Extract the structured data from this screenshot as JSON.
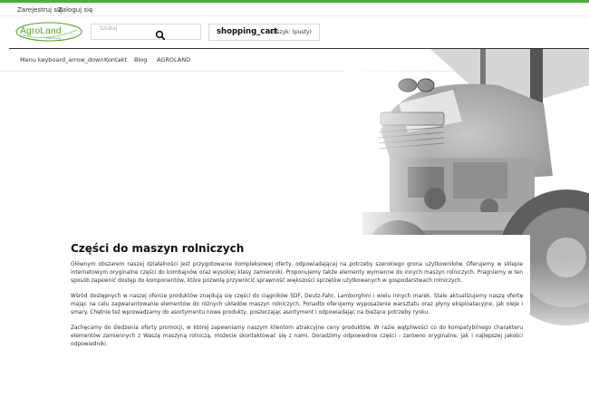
{
  "auth": {
    "register": "Zarejestruj się",
    "login": "Zaloguj się"
  },
  "header": {
    "logo_text": "AgroLand",
    "logo_subtext": "części maszyn",
    "search_placeholder": "Szukaj",
    "search_icon": "search-icon",
    "cart_icon_name": "shopping_cart",
    "cart_status": "Koszyk: (pusty)"
  },
  "nav": {
    "items": [
      {
        "label": "Menu keyboard_arrow_down"
      },
      {
        "label": "Kontakt"
      },
      {
        "label": "Blog"
      },
      {
        "label": "AGROLAND"
      }
    ]
  },
  "content": {
    "title": "Części do maszyn rolniczych",
    "paragraphs": [
      "Głównym obszarem naszej działalności jest przygotowanie kompleksowej oferty, odpowiadającej na potrzeby szerokiego grona użytkowników. Oferujemy w sklepie internetowym oryginalne części do kombajnów oraz wysokiej klasy zamienniki. Proponujemy także elementy wymienne do innych maszyn rolniczych. Pragniemy w ten sposób zapewnić dostęp do komponentów, które pozwolą przywrócić sprawność większości sprzętów użytkowanych w gospodarstwach rolniczych.",
      "Wśród dostępnych w naszej ofercie produktów znajdują się części do ciągników SDF, Deutz-Fahr, Lamborghini i wielu innych marek. Stale aktualizujemy naszą ofertę mając na celu zagwarantowanie elementów do różnych układów maszyn rolniczych. Ponadto oferujemy wyposażenie warsztatu oraz płyny eksploatacyjne, jak oleje i smary. Chętnie też wprowadzamy do asortymentu nowe produkty, poszerzając asortyment i odpowiadając na bieżące potrzeby rynku.",
      "Zachęcamy do śledzenia oferty promocji, w której zapewniamy naszym klientom atrakcyjne ceny produktów. W razie wątpliwości co do kompatybilnego charakteru elementów zamiennych z Waszą maszyną rolniczą, możecie skontaktować się z nami. Doradzimy odpowiednie części - zarówno oryginalne, jak i najlepszej jakości odpowiedniki."
    ]
  },
  "colors": {
    "accent_green": "#4caf32",
    "logo_green": "#5aa32a"
  }
}
